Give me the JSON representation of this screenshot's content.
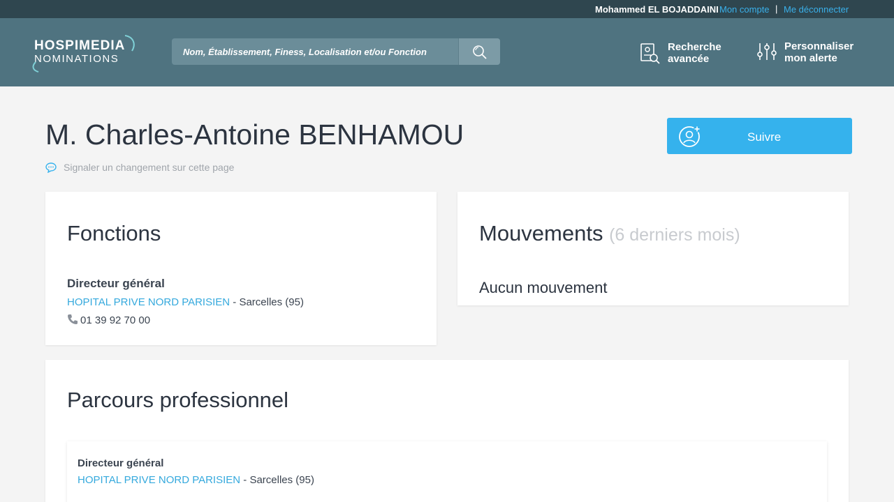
{
  "userbar": {
    "user_name": "Mohammed EL BOJADDAINI",
    "account_link": "Mon compte",
    "separator": "|",
    "logout_link": "Me déconnecter"
  },
  "header": {
    "logo_line1": "HOSPIMEDIA",
    "logo_line2": "NOMINATIONS",
    "search_placeholder": "Nom, Établissement, Finess, Localisation et/ou Fonction",
    "search_icon": "search-icon",
    "advanced_search_line1": "Recherche",
    "advanced_search_line2": "avancée",
    "alert_line1": "Personnaliser",
    "alert_line2": "mon alerte"
  },
  "profile": {
    "name": "M. Charles-Antoine BENHAMOU",
    "report_link": "Signaler un changement sur cette page",
    "follow_label": "Suivre"
  },
  "fonctions": {
    "title": "Fonctions",
    "role": "Directeur général",
    "org": "HOPITAL PRIVE NORD PARISIEN",
    "location": " - Sarcelles (95)",
    "phone": "01 39 92 70 00"
  },
  "mouvements": {
    "title": "Mouvements",
    "subtitle": "(6 derniers mois)",
    "empty": "Aucun mouvement"
  },
  "parcours": {
    "title": "Parcours professionnel",
    "items": [
      {
        "role": "Directeur général",
        "org": "HOPITAL PRIVE NORD PARISIEN",
        "location": " - Sarcelles (95)"
      }
    ]
  },
  "colors": {
    "header_bg": "#4f7380",
    "userbar_bg": "#2f464f",
    "accent": "#35b2ed",
    "link": "#35a9dd"
  }
}
